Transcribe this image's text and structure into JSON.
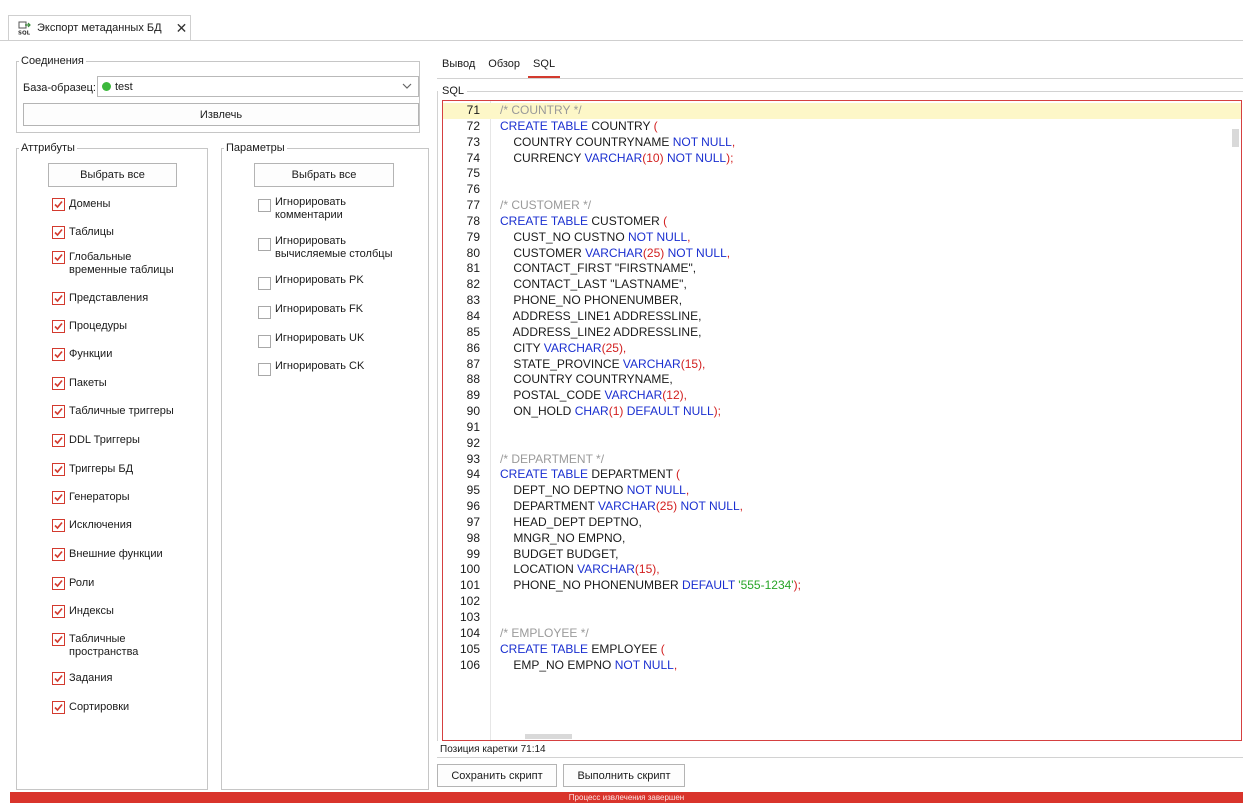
{
  "window": {
    "tab_title": "Экспорт метаданных БД",
    "tab_icon": "sql-export-icon",
    "close_icon": "close-icon"
  },
  "connections": {
    "legend": "Соединения",
    "db_label": "База-образец:",
    "db_value": "test",
    "db_status_color": "#3cb83c",
    "extract_label": "Извлечь"
  },
  "attributes": {
    "legend": "Аттрибуты",
    "select_all_label": "Выбрать все",
    "items": [
      {
        "label": "Домены",
        "checked": true
      },
      {
        "label": "Таблицы",
        "checked": true
      },
      {
        "label": "Глобальные временные таблицы",
        "checked": true
      },
      {
        "label": "Представления",
        "checked": true
      },
      {
        "label": "Процедуры",
        "checked": true
      },
      {
        "label": "Функции",
        "checked": true
      },
      {
        "label": "Пакеты",
        "checked": true
      },
      {
        "label": "Табличные триггеры",
        "checked": true
      },
      {
        "label": "DDL Триггеры",
        "checked": true
      },
      {
        "label": "Триггеры БД",
        "checked": true
      },
      {
        "label": "Генераторы",
        "checked": true
      },
      {
        "label": "Исключения",
        "checked": true
      },
      {
        "label": "Внешние функции",
        "checked": true
      },
      {
        "label": "Роли",
        "checked": true
      },
      {
        "label": "Индексы",
        "checked": true
      },
      {
        "label": "Табличные пространства",
        "checked": true
      },
      {
        "label": "Задания",
        "checked": true
      },
      {
        "label": "Сортировки",
        "checked": true
      }
    ]
  },
  "parameters": {
    "legend": "Параметры",
    "select_all_label": "Выбрать все",
    "items": [
      {
        "label": "Игнорировать комментарии",
        "checked": false
      },
      {
        "label": "Игнорировать вычисляемые столбцы",
        "checked": false
      },
      {
        "label": "Игнорировать PK",
        "checked": false
      },
      {
        "label": "Игнорировать FK",
        "checked": false
      },
      {
        "label": "Игнорировать UK",
        "checked": false
      },
      {
        "label": "Игнорировать CK",
        "checked": false
      }
    ]
  },
  "right": {
    "tabs": [
      {
        "label": "Вывод",
        "active": false
      },
      {
        "label": "Обзор",
        "active": false
      },
      {
        "label": "SQL",
        "active": true
      }
    ],
    "sql_legend": "SQL",
    "caret_position": "Позиция каретки 71:14",
    "save_script_label": "Сохранить скрипт",
    "run_script_label": "Выполнить скрипт"
  },
  "editor": {
    "current_line": 71,
    "lines": [
      {
        "n": "71",
        "tokens": [
          [
            "cm",
            "/* COUNTRY */"
          ]
        ]
      },
      {
        "n": "72",
        "tokens": [
          [
            "kw",
            "CREATE TABLE "
          ],
          [
            "id",
            "COUNTRY "
          ],
          [
            "pn",
            "("
          ]
        ]
      },
      {
        "n": "73",
        "tokens": [
          [
            "id",
            "    COUNTRY COUNTRYNAME "
          ],
          [
            "kw",
            "NOT NULL"
          ],
          [
            "pn",
            ","
          ]
        ]
      },
      {
        "n": "74",
        "tokens": [
          [
            "id",
            "    CURRENCY "
          ],
          [
            "kw",
            "VARCHAR"
          ],
          [
            "pn",
            "(10) "
          ],
          [
            "kw",
            "NOT NULL"
          ],
          [
            "pn",
            ");"
          ]
        ]
      },
      {
        "n": "75",
        "tokens": []
      },
      {
        "n": "76",
        "tokens": []
      },
      {
        "n": "77",
        "tokens": [
          [
            "cm",
            "/* CUSTOMER */"
          ]
        ]
      },
      {
        "n": "78",
        "tokens": [
          [
            "kw",
            "CREATE TABLE "
          ],
          [
            "id",
            "CUSTOMER "
          ],
          [
            "pn",
            "("
          ]
        ]
      },
      {
        "n": "79",
        "tokens": [
          [
            "id",
            "    CUST_NO CUSTNO "
          ],
          [
            "kw",
            "NOT NULL"
          ],
          [
            "pn",
            ","
          ]
        ]
      },
      {
        "n": "80",
        "tokens": [
          [
            "id",
            "    CUSTOMER "
          ],
          [
            "kw",
            "VARCHAR"
          ],
          [
            "pn",
            "(25) "
          ],
          [
            "kw",
            "NOT NULL"
          ],
          [
            "pn",
            ","
          ]
        ]
      },
      {
        "n": "81",
        "tokens": [
          [
            "id",
            "    CONTACT_FIRST \"FIRSTNAME\","
          ]
        ]
      },
      {
        "n": "82",
        "tokens": [
          [
            "id",
            "    CONTACT_LAST \"LASTNAME\","
          ]
        ]
      },
      {
        "n": "83",
        "tokens": [
          [
            "id",
            "    PHONE_NO PHONENUMBER,"
          ]
        ]
      },
      {
        "n": "84",
        "tokens": [
          [
            "id",
            "    ADDRESS_LINE1 ADDRESSLINE,"
          ]
        ]
      },
      {
        "n": "85",
        "tokens": [
          [
            "id",
            "    ADDRESS_LINE2 ADDRESSLINE,"
          ]
        ]
      },
      {
        "n": "86",
        "tokens": [
          [
            "id",
            "    CITY "
          ],
          [
            "kw",
            "VARCHAR"
          ],
          [
            "pn",
            "(25),"
          ]
        ]
      },
      {
        "n": "87",
        "tokens": [
          [
            "id",
            "    STATE_PROVINCE "
          ],
          [
            "kw",
            "VARCHAR"
          ],
          [
            "pn",
            "(15),"
          ]
        ]
      },
      {
        "n": "88",
        "tokens": [
          [
            "id",
            "    COUNTRY COUNTRYNAME,"
          ]
        ]
      },
      {
        "n": "89",
        "tokens": [
          [
            "id",
            "    POSTAL_CODE "
          ],
          [
            "kw",
            "VARCHAR"
          ],
          [
            "pn",
            "(12),"
          ]
        ]
      },
      {
        "n": "90",
        "tokens": [
          [
            "id",
            "    ON_HOLD "
          ],
          [
            "kw",
            "CHAR"
          ],
          [
            "pn",
            "(1) "
          ],
          [
            "kw",
            "DEFAULT NULL"
          ],
          [
            "pn",
            ");"
          ]
        ]
      },
      {
        "n": "91",
        "tokens": []
      },
      {
        "n": "92",
        "tokens": []
      },
      {
        "n": "93",
        "tokens": [
          [
            "cm",
            "/* DEPARTMENT */"
          ]
        ]
      },
      {
        "n": "94",
        "tokens": [
          [
            "kw",
            "CREATE TABLE "
          ],
          [
            "id",
            "DEPARTMENT "
          ],
          [
            "pn",
            "("
          ]
        ]
      },
      {
        "n": "95",
        "tokens": [
          [
            "id",
            "    DEPT_NO DEPTNO "
          ],
          [
            "kw",
            "NOT NULL"
          ],
          [
            "pn",
            ","
          ]
        ]
      },
      {
        "n": "96",
        "tokens": [
          [
            "id",
            "    DEPARTMENT "
          ],
          [
            "kw",
            "VARCHAR"
          ],
          [
            "pn",
            "(25) "
          ],
          [
            "kw",
            "NOT NULL"
          ],
          [
            "pn",
            ","
          ]
        ]
      },
      {
        "n": "97",
        "tokens": [
          [
            "id",
            "    HEAD_DEPT DEPTNO,"
          ]
        ]
      },
      {
        "n": "98",
        "tokens": [
          [
            "id",
            "    MNGR_NO EMPNO,"
          ]
        ]
      },
      {
        "n": "99",
        "tokens": [
          [
            "id",
            "    BUDGET BUDGET,"
          ]
        ]
      },
      {
        "n": "100",
        "tokens": [
          [
            "id",
            "    LOCATION "
          ],
          [
            "kw",
            "VARCHAR"
          ],
          [
            "pn",
            "(15),"
          ]
        ]
      },
      {
        "n": "101",
        "tokens": [
          [
            "id",
            "    PHONE_NO PHONENUMBER "
          ],
          [
            "kw",
            "DEFAULT "
          ],
          [
            "st",
            "'555-1234'"
          ],
          [
            "pn",
            ");"
          ]
        ]
      },
      {
        "n": "102",
        "tokens": []
      },
      {
        "n": "103",
        "tokens": []
      },
      {
        "n": "104",
        "tokens": [
          [
            "cm",
            "/* EMPLOYEE */"
          ]
        ]
      },
      {
        "n": "105",
        "tokens": [
          [
            "kw",
            "CREATE TABLE "
          ],
          [
            "id",
            "EMPLOYEE "
          ],
          [
            "pn",
            "("
          ]
        ]
      },
      {
        "n": "106",
        "tokens": [
          [
            "id",
            "    EMP_NO EMPNO "
          ],
          [
            "kw",
            "NOT NULL"
          ],
          [
            "pn",
            ","
          ]
        ]
      }
    ]
  },
  "status": {
    "message": "Процесс извлечения завершен",
    "color": "#d9342b"
  }
}
